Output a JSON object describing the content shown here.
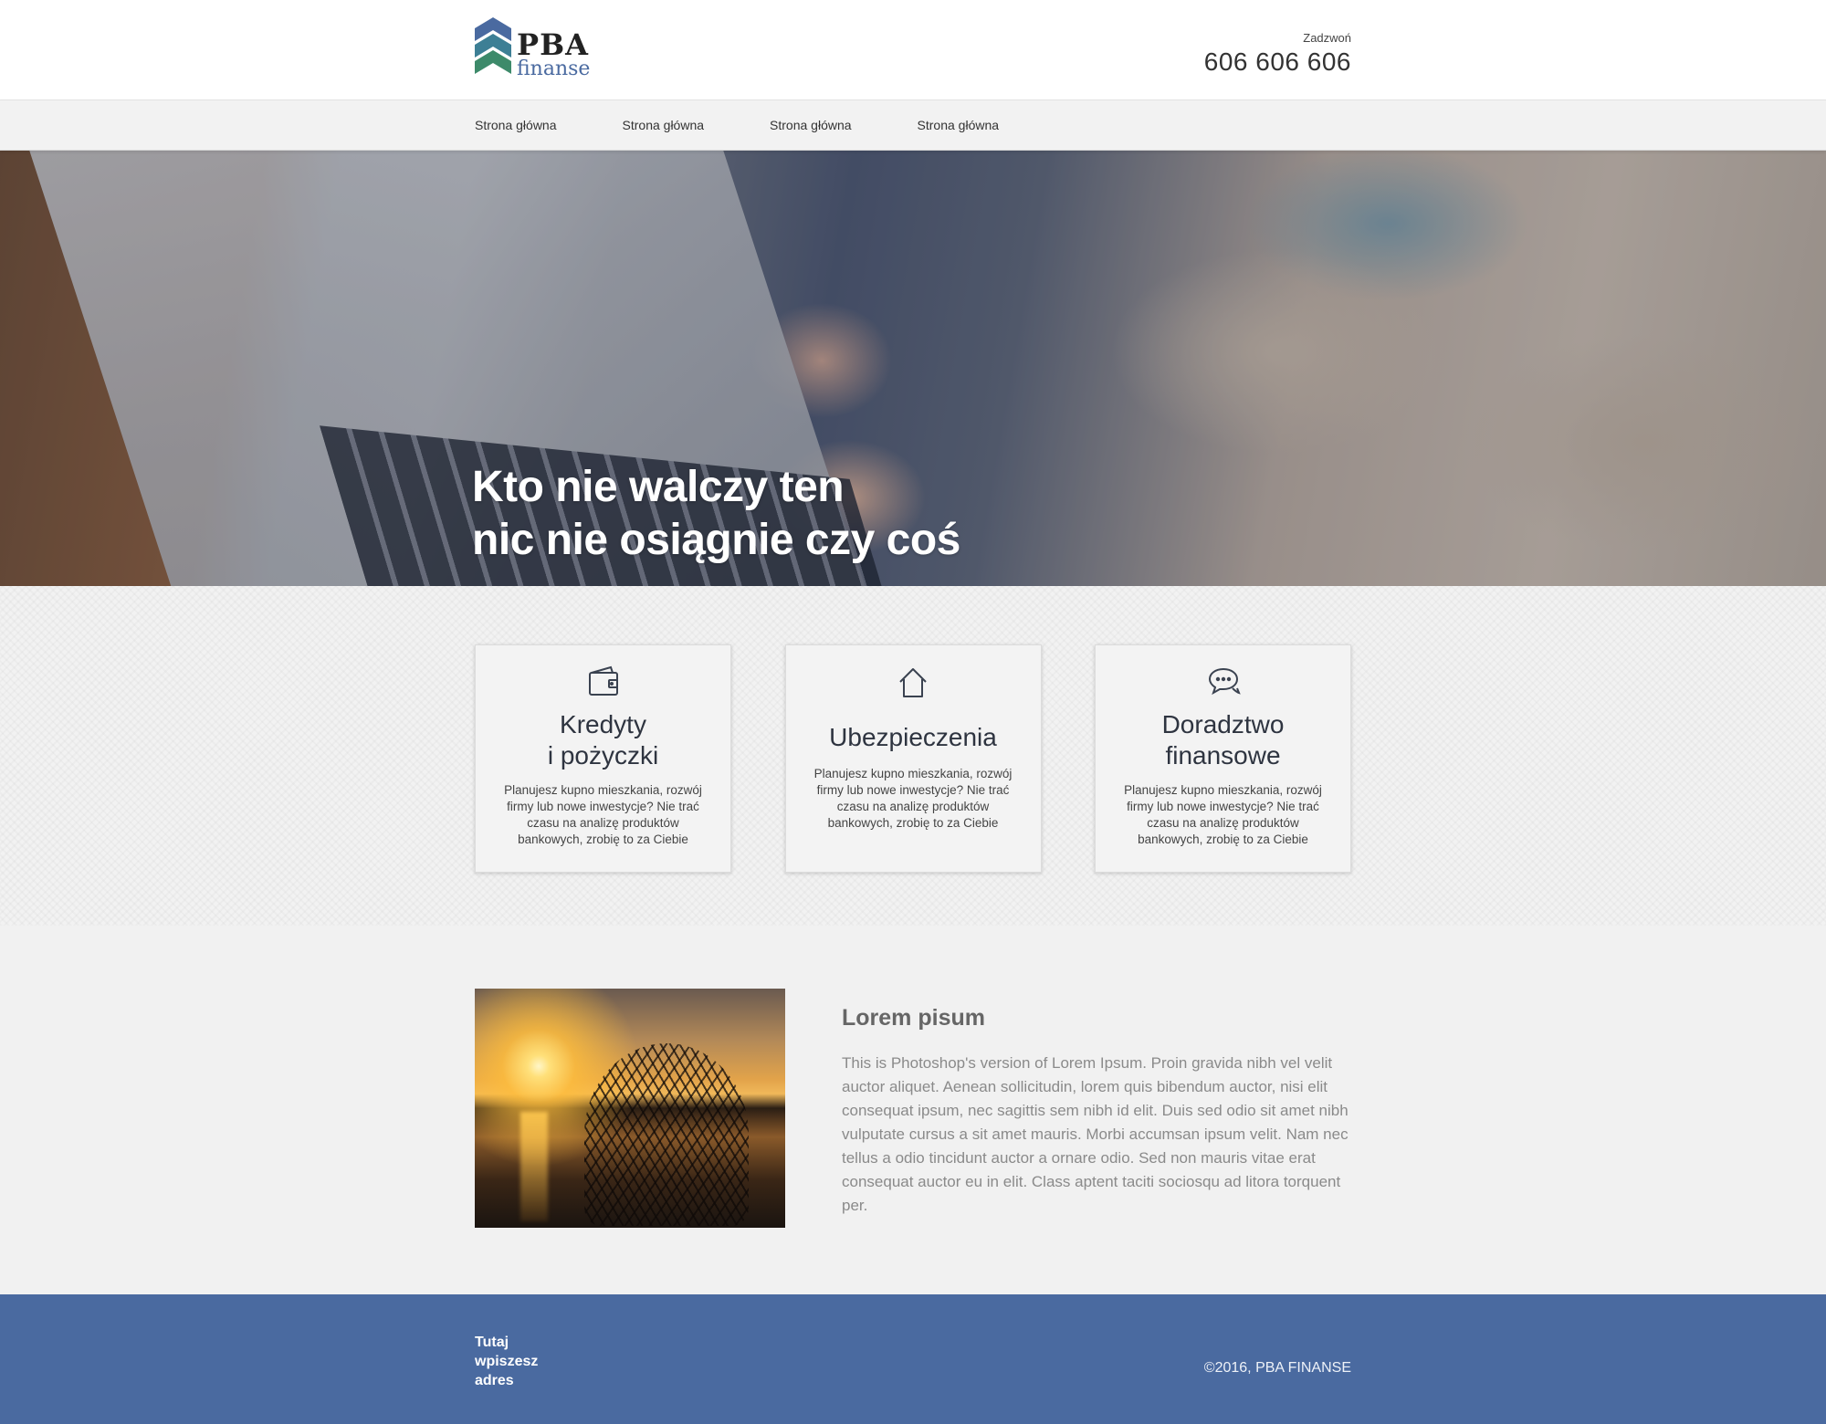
{
  "header": {
    "logo": {
      "line1": "PBA",
      "line2": "finanse"
    },
    "call_label": "Zadzwoń",
    "phone": "606 606 606"
  },
  "nav": {
    "items": [
      {
        "label": "Strona główna"
      },
      {
        "label": "Strona główna"
      },
      {
        "label": "Strona główna"
      },
      {
        "label": "Strona główna"
      }
    ]
  },
  "hero": {
    "title_line1": "Kto nie walczy ten",
    "title_line2": "nic nie osiągnie czy coś"
  },
  "cards": [
    {
      "icon": "wallet-icon",
      "title_line1": "Kredyty",
      "title_line2": "i pożyczki",
      "text": "Planujesz kupno mieszkania, rozwój firmy lub nowe inwestycje? Nie trać czasu na analizę produktów bankowych, zrobię to za Ciebie"
    },
    {
      "icon": "house-icon",
      "title_line1": "Ubezpieczenia",
      "title_line2": "",
      "text": "Planujesz kupno mieszkania, rozwój firmy lub nowe inwestycje? Nie trać czasu na analizę produktów bankowych, zrobię to za Ciebie"
    },
    {
      "icon": "chat-icon",
      "title_line1": "Doradztwo",
      "title_line2": "finansowe",
      "text": "Planujesz kupno mieszkania, rozwój firmy lub nowe inwestycje? Nie trać czasu na analizę produktów bankowych, zrobię to za Ciebie"
    }
  ],
  "about": {
    "title": "Lorem pisum",
    "text": "This is Photoshop's version  of Lorem Ipsum. Proin gravida nibh vel velit auctor aliquet. Aenean sollicitudin, lorem quis bibendum auctor, nisi elit consequat ipsum, nec sagittis sem nibh id elit. Duis sed odio sit amet nibh vulputate cursus a sit amet mauris. Morbi accumsan ipsum velit. Nam nec tellus a odio tincidunt auctor a ornare odio. Sed non  mauris vitae erat consequat auctor eu in elit. Class aptent taciti sociosqu ad litora torquent per."
  },
  "footer": {
    "address": "Tutaj\nwpiszesz\nadres",
    "copyright": "©2016, PBA FINANSE"
  },
  "colors": {
    "footer_bg": "#4a6aa0",
    "logo_blue": "#4a6aa0",
    "logo_green": "#3d8a6a"
  }
}
